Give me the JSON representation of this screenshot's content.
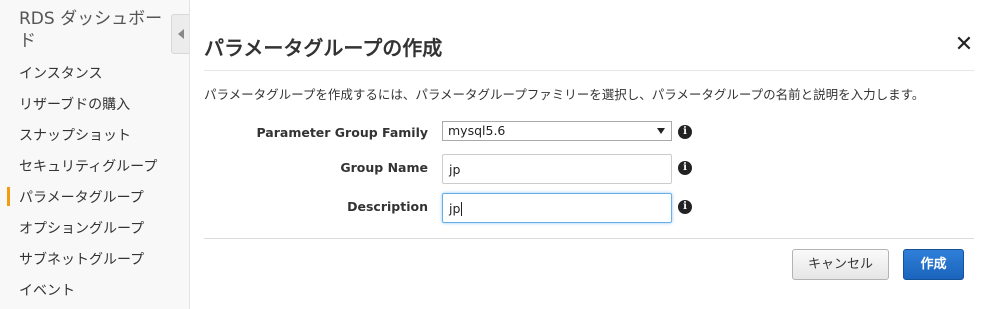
{
  "sidebar": {
    "title": "RDS ダッシュボード",
    "items": [
      {
        "label": "インスタンス"
      },
      {
        "label": "リザーブドの購入"
      },
      {
        "label": "スナップショット"
      },
      {
        "label": "セキュリティグループ"
      },
      {
        "label": "パラメータグループ"
      },
      {
        "label": "オプショングループ"
      },
      {
        "label": "サブネットグループ"
      },
      {
        "label": "イベント"
      }
    ],
    "active_index": 4
  },
  "dialog": {
    "title": "パラメータグループの作成",
    "close_glyph": "✕",
    "intro": "パラメータグループを作成するには、パラメータグループファミリーを選択し、パラメータグループの名前と説明を入力します。",
    "fields": {
      "family": {
        "label": "Parameter Group Family",
        "value": "mysql5.6"
      },
      "name": {
        "label": "Group Name",
        "value": "jp"
      },
      "description": {
        "label": "Description",
        "value": "jp"
      }
    },
    "info_glyph": "i",
    "buttons": {
      "cancel": "キャンセル",
      "create": "作成"
    }
  },
  "colors": {
    "active_indicator": "#f39c12",
    "primary_button": "#1f6fcb",
    "focus_border": "#66afe9"
  }
}
